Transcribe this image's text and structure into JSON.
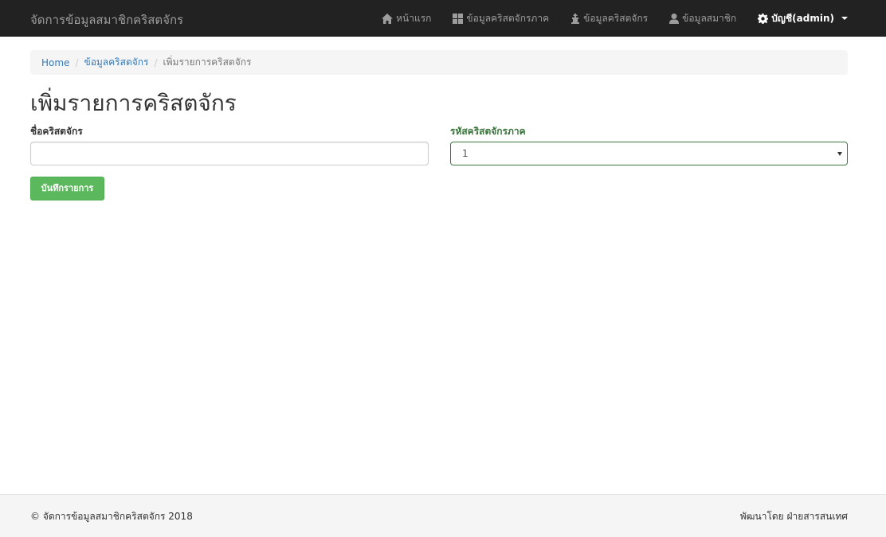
{
  "navbar": {
    "brand": "จัดการข้อมูลสมาชิกคริสตจักร",
    "items": [
      {
        "label": "หน้าแรก",
        "icon": "home-icon"
      },
      {
        "label": "ข้อมูลคริสตจักรภาค",
        "icon": "grid-icon"
      },
      {
        "label": "ข้อมูลคริสตจักร",
        "icon": "church-icon"
      },
      {
        "label": "ข้อมูลสมาชิก",
        "icon": "user-icon"
      }
    ],
    "account": {
      "label": "บัญชี(admin)",
      "icon": "gear-icon"
    }
  },
  "breadcrumb": {
    "home": "Home",
    "section": "ข้อมูลคริสตจักร",
    "current": "เพิ่มรายการคริสตจักร"
  },
  "page": {
    "title": "เพิ่มรายการคริสตจักร"
  },
  "form": {
    "name_label": "ชื่อคริสตจักร",
    "name_value": "",
    "region_label": "รหัสคริสตจักรภาค",
    "region_value": "1",
    "submit_label": "บันทึกรายการ"
  },
  "footer": {
    "left": "© จัดการข้อมูลสมาชิกคริสตจักร 2018",
    "right": "พัฒนาโดย ฝ่ายสารสนเทศ"
  },
  "colors": {
    "navbar_bg": "#222222",
    "success_green": "#5cb85c",
    "success_text": "#3c763d",
    "link_blue": "#337ab7"
  }
}
